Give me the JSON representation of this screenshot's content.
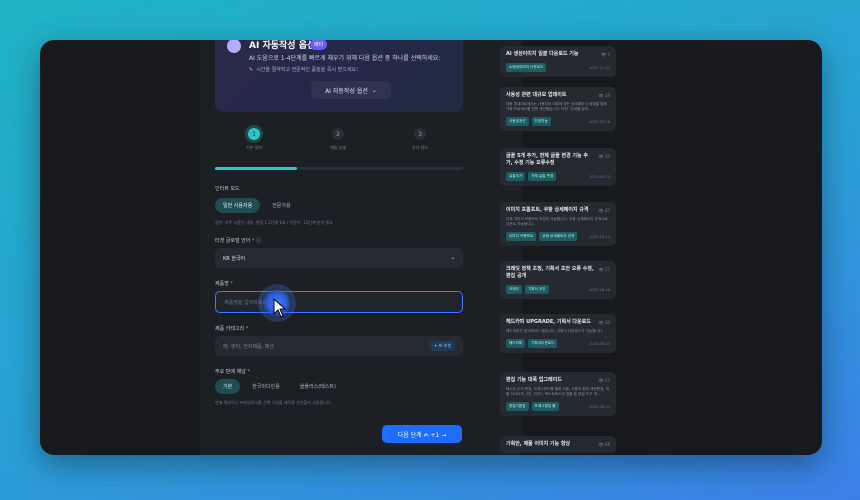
{
  "colors": {
    "accent": "#2fc6c9",
    "primary": "#1f6dff",
    "hero_badge": "#6b5cff"
  },
  "hero": {
    "title": "AI 자동작성 옵션",
    "badge": "베타",
    "desc": "AI 도움으로 1-4단계를 빠르게 채우기 위해 다음 옵션 중 하나를 선택하세요:",
    "hint": "시간을 절약하고 전문적인 품질을 즉시 받으세요!",
    "dropdown_label": "AI 자동작성 옵션"
  },
  "steps": [
    {
      "num": "1",
      "label": "기본 정보"
    },
    {
      "num": "2",
      "label": "제품 상세"
    },
    {
      "num": "3",
      "label": "추가 정보"
    }
  ],
  "progress": 0.33,
  "form": {
    "mode_label": "인터뷰 모드",
    "mode_options": [
      "일반 사용자용",
      "전문가용"
    ],
    "mode_hint": "일반: 자주 사용된 내용, 친절 1 2단계 1회 / 전문가: 12단계 분석 필요",
    "language_label": "타겟 글로벌 언어",
    "language_value": "KR 한국어",
    "product_name_label": "제품명",
    "product_name_placeholder": "제품명을 입력하세요",
    "category_label": "제품 카테고리",
    "category_placeholder": "예: 뷰티, 전자제품, 패션",
    "category_ai_chip": "✦ AI 추천",
    "channel_label": "주요 판매 채널",
    "channel_options": [
      "기본",
      "한국이다인용",
      "올플러스(테스트)"
    ],
    "channel_hint": "판매 채널이나 프레임워크를 선택 구성할 제작을 추천할지 사용합니다.",
    "next_button": "다음 단계 ✍ +1 →"
  },
  "cards": [
    {
      "title": "AI 생성이미지 일괄 다운로드 기능",
      "desc": "",
      "views": "7",
      "tags": [
        "AI생성이미지 다운로드"
      ],
      "date": "2025-11-03"
    },
    {
      "title": "사용성 관련 대규모 업데이트",
      "desc": "대한 업데이트에서는 사용자의 리뷰에 맞는 상세페이지 생성을 위해 기획 프로세스를 전면 개선했습니다. 또한, 단계별 입력...",
      "views": "34",
      "tags": [
        "사용성개선",
        "인공지능"
      ],
      "date": "2025-09-28"
    },
    {
      "title": "글꼴 5개 추가, 전체 글꼴 변경 기능 추가, 수정 기능 오류수정",
      "desc": "",
      "views": "35",
      "tags": [
        "글꼴추가",
        "전체 글꼴 변경"
      ],
      "date": "2025-09-15"
    },
    {
      "title": "이미지 프롬프트, 쿠팡 상세페이지 규격",
      "desc": "이제 이미지 프롬프트 작성이 가능합니다. 쿠팡 상세페이지 규격으로 다운로 가능합니다.",
      "views": "47",
      "tags": [
        "이미지 프롬프트",
        "쿠팡 상세페이지 규격"
      ],
      "date": "2025-09-10"
    },
    {
      "title": "크레딧 정책 조정, 기획서 초안 오류 수정, 편집 공개",
      "desc": "",
      "views": "27",
      "tags": [
        "크레딧",
        "기획서 초안"
      ],
      "date": "2025-08-16"
    },
    {
      "title": "헤드카피 UPGRADE, 기획서 다운로드",
      "desc": "헤드카피가 업그레이드 됐습니다. 기획서 다운로드가 가능합니다.",
      "views": "32",
      "tags": [
        "헤드카피",
        "기획서다운로드"
      ],
      "date": "2025-08-03"
    },
    {
      "title": "편집 기능 대폭 업그레이드",
      "desc": "텍스트 순서 변경, 드래그앤드롭 블록 이동, 사용자 원하 색상변경, 개별 리사이즈, 2단 그리드, 텍스트박스의 정렬 등 편집 도구 개...",
      "views": "27",
      "tags": [
        "편집기편집",
        "프레그편집 툴"
      ],
      "date": "2025-08-01"
    },
    {
      "title": "기획안, 제품 이미지 기능 향상",
      "desc": "",
      "views": "66",
      "tags": [],
      "date": ""
    }
  ]
}
